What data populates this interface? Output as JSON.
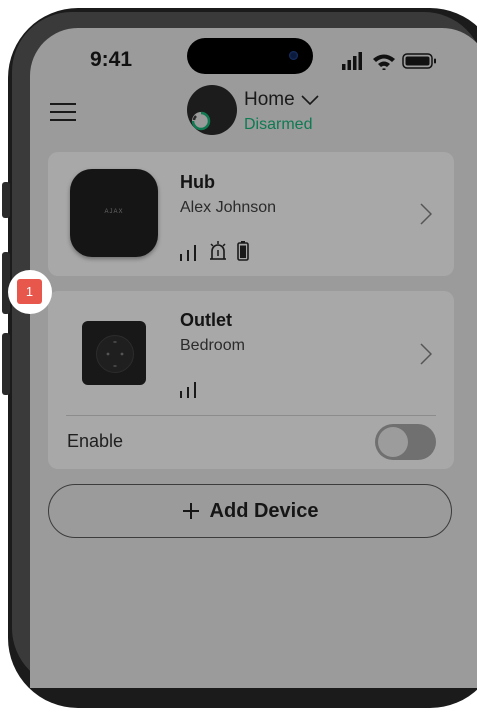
{
  "status_bar": {
    "time": "9:41",
    "icons": [
      "signal-icon",
      "wifi-icon",
      "battery-icon"
    ]
  },
  "header": {
    "space_name": "Home",
    "security_state": "Disarmed",
    "menu_icon": "hamburger-icon",
    "dropdown_icon": "chevron-down-icon"
  },
  "devices": [
    {
      "name": "Hub",
      "room": "Alex Johnson",
      "image_logo": "AJAX",
      "status_icons": [
        "signal-strength-icon",
        "siren-icon",
        "battery-icon"
      ]
    },
    {
      "name": "Outlet",
      "room": "Bedroom",
      "status_icons": [
        "signal-strength-icon"
      ],
      "callout_number": "1",
      "toggle_label": "Enable",
      "toggle_on": false
    }
  ],
  "add_device": {
    "label": "Add Device",
    "icon": "plus-icon"
  },
  "colors": {
    "screen_overlay": "#9b9b9b",
    "card": "#a8a8a8",
    "disarmed_text": "#0f7a52",
    "callout_badge": "#e8574b"
  }
}
